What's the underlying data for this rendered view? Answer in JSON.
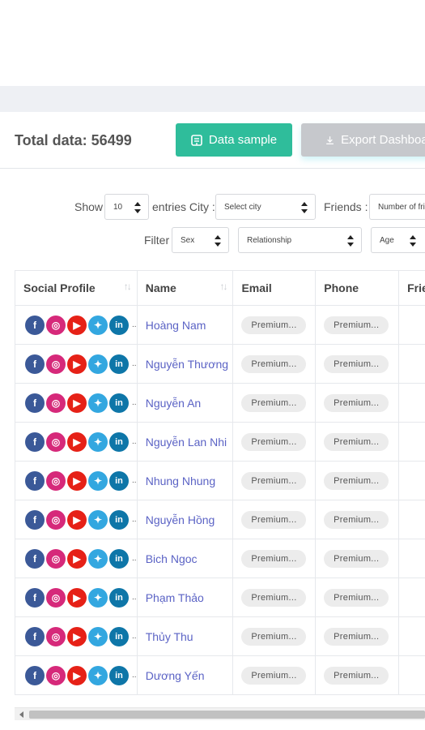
{
  "summary": {
    "total_label": "Total data: 56499"
  },
  "buttons": {
    "data_sample": "Data sample",
    "export": "Export Dashboard"
  },
  "filters": {
    "show_label": "Show",
    "entries_value": "10",
    "entries_city_label": "entries City :",
    "city_value": "Select city",
    "friends_label": "Friends :",
    "friends_value": "Number of friends",
    "filter_label": "Filter",
    "sex_value": "Sex",
    "relationship_value": "Relationship",
    "age_value": "Age"
  },
  "table": {
    "headers": [
      "Social Profile",
      "Name",
      "Email",
      "Phone",
      "Friends"
    ],
    "rows": [
      {
        "name": "Hoàng Nam",
        "email": "Premium...",
        "phone": "Premium..."
      },
      {
        "name": "Nguyễn Thương",
        "email": "Premium...",
        "phone": "Premium..."
      },
      {
        "name": "Nguyễn An",
        "email": "Premium...",
        "phone": "Premium..."
      },
      {
        "name": "Nguyễn Lan Nhi",
        "email": "Premium...",
        "phone": "Premium..."
      },
      {
        "name": "Nhung Nhung",
        "email": "Premium...",
        "phone": "Premium..."
      },
      {
        "name": "Nguyễn Hồng",
        "email": "Premium...",
        "phone": "Premium..."
      },
      {
        "name": "Bich Ngoc",
        "email": "Premium...",
        "phone": "Premium..."
      },
      {
        "name": "Phạm Thảo",
        "email": "Premium...",
        "phone": "Premium..."
      },
      {
        "name": "Thủy Thu",
        "email": "Premium...",
        "phone": "Premium..."
      },
      {
        "name": "Dương Yến",
        "email": "Premium...",
        "phone": "Premium..."
      }
    ]
  },
  "social_icons": [
    "facebook-icon",
    "instagram-icon",
    "youtube-icon",
    "twitter-icon",
    "linkedin-icon"
  ],
  "colors": {
    "accent_green": "#2fbd9b",
    "link_purple": "#5b63c5",
    "disabled_grey": "#c6c8cc"
  }
}
